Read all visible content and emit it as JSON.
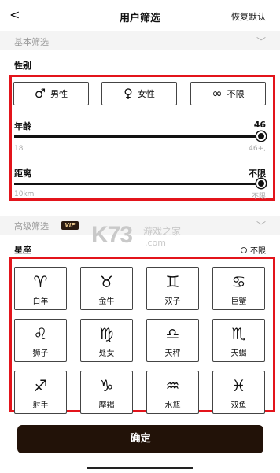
{
  "header": {
    "back_glyph": "<",
    "title": "用户筛选",
    "reset_label": "恢复默认"
  },
  "basic_section": {
    "title": "基本筛选",
    "chevron": "chevron-down-icon"
  },
  "gender": {
    "label": "性别",
    "options": [
      {
        "icon": "male-icon",
        "glyph": "♂",
        "label": "男性"
      },
      {
        "icon": "female-icon",
        "glyph": "♀",
        "label": "女性"
      },
      {
        "icon": "infinity-icon",
        "glyph": "∞",
        "label": "不限"
      }
    ]
  },
  "age": {
    "label": "年龄",
    "value": "46",
    "min_label": "18",
    "max_label": "46+",
    "level": 1.0
  },
  "distance": {
    "label": "距离",
    "value": "不限",
    "min_label": "10km",
    "max_label": "不限",
    "level": 1.0
  },
  "advanced_section": {
    "title": "高级筛选",
    "badge": "VIP",
    "chevron": "chevron-down-icon"
  },
  "zodiac": {
    "label": "星座",
    "unlimited_label": "不限",
    "signs": [
      {
        "glyph": "♈",
        "name": "白羊"
      },
      {
        "glyph": "♉",
        "name": "金牛"
      },
      {
        "glyph": "♊",
        "name": "双子"
      },
      {
        "glyph": "♋",
        "name": "巨蟹"
      },
      {
        "glyph": "♌",
        "name": "狮子"
      },
      {
        "glyph": "♍",
        "name": "处女"
      },
      {
        "glyph": "♎",
        "name": "天秤"
      },
      {
        "glyph": "♏",
        "name": "天蝎"
      },
      {
        "glyph": "♐",
        "name": "射手"
      },
      {
        "glyph": "♑",
        "name": "摩羯"
      },
      {
        "glyph": "♒",
        "name": "水瓶"
      },
      {
        "glyph": "♓",
        "name": "双鱼"
      }
    ]
  },
  "watermark": {
    "brand": "K73",
    "cn": "游戏之家",
    "domain": ".com"
  },
  "confirm_label": "确定",
  "colors": {
    "highlight": "#e3141b",
    "confirm_bg": "#221208",
    "vip_gold": "#e8c58a"
  }
}
